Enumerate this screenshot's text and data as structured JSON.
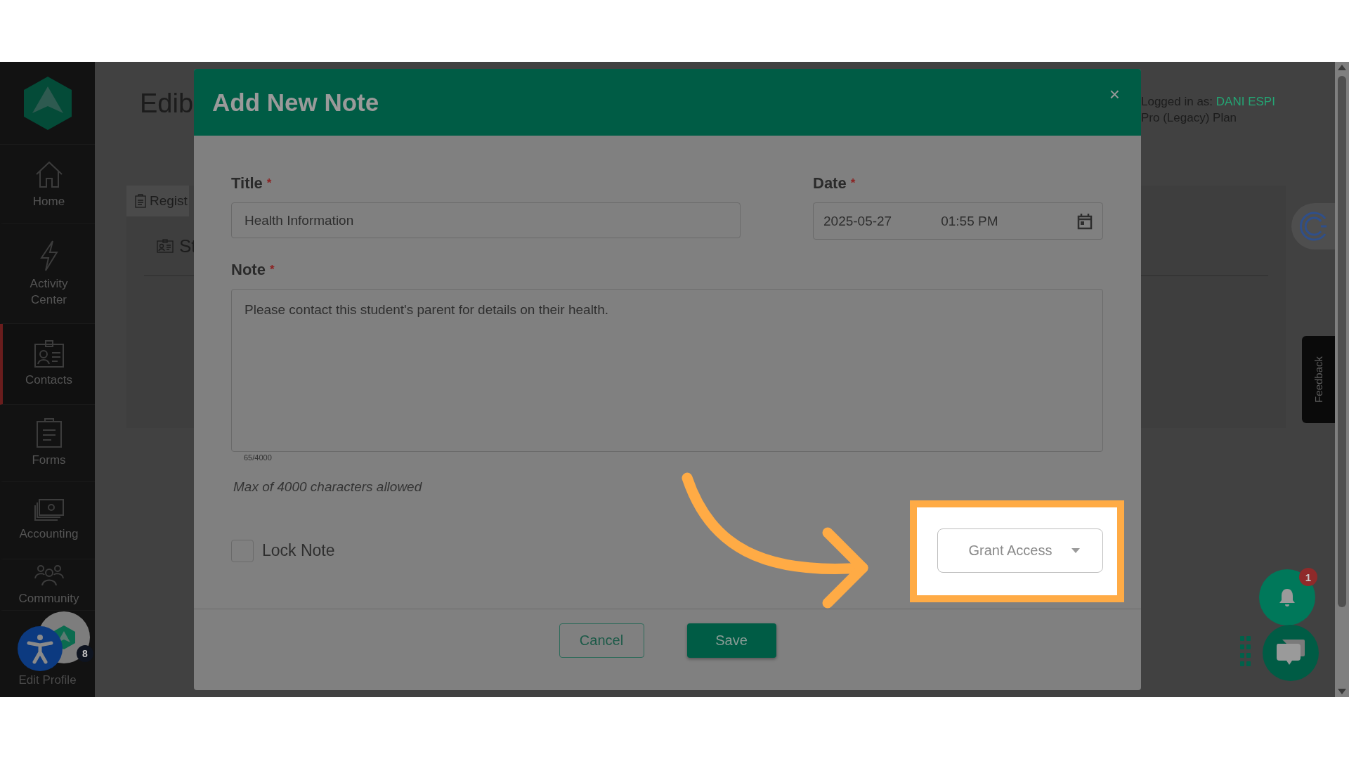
{
  "sidebar": {
    "items": [
      {
        "label": "Home",
        "selected": false
      },
      {
        "label": "Activity Center",
        "selected": false
      },
      {
        "label": "Contacts",
        "selected": true
      },
      {
        "label": "Forms",
        "selected": false
      },
      {
        "label": "Accounting",
        "selected": false
      },
      {
        "label": "Community",
        "selected": false
      }
    ],
    "profile": {
      "label": "Edit Profile",
      "badge": "8"
    }
  },
  "page": {
    "title": "Edib",
    "tabs": [
      {
        "label": "Regist",
        "selected": true
      }
    ],
    "section": "St",
    "login_prefix": "Logged in as:",
    "user": "DANI ESPI",
    "plan": "Pro (Legacy) Plan"
  },
  "modal": {
    "title": "Add New Note",
    "close": "×",
    "title_field": {
      "label": "Title",
      "required": "*",
      "value": "Health Information"
    },
    "date_field": {
      "label": "Date",
      "required": "*",
      "date": "2025-05-27",
      "time": "01:55 PM"
    },
    "note_field": {
      "label": "Note",
      "required": "*",
      "value": "Please contact this student's parent for details on their health.",
      "counter": "65/4000"
    },
    "hint": "Max of 4000 characters allowed",
    "lock": {
      "label": "Lock Note",
      "checked": false
    },
    "access": {
      "placeholder": "Grant Access"
    },
    "buttons": [
      {
        "label": "Cancel",
        "kind": "secondary"
      },
      {
        "label": "Save",
        "kind": "primary"
      }
    ]
  },
  "widgets": {
    "feedback": "Feedback",
    "notification_badge": "1"
  }
}
